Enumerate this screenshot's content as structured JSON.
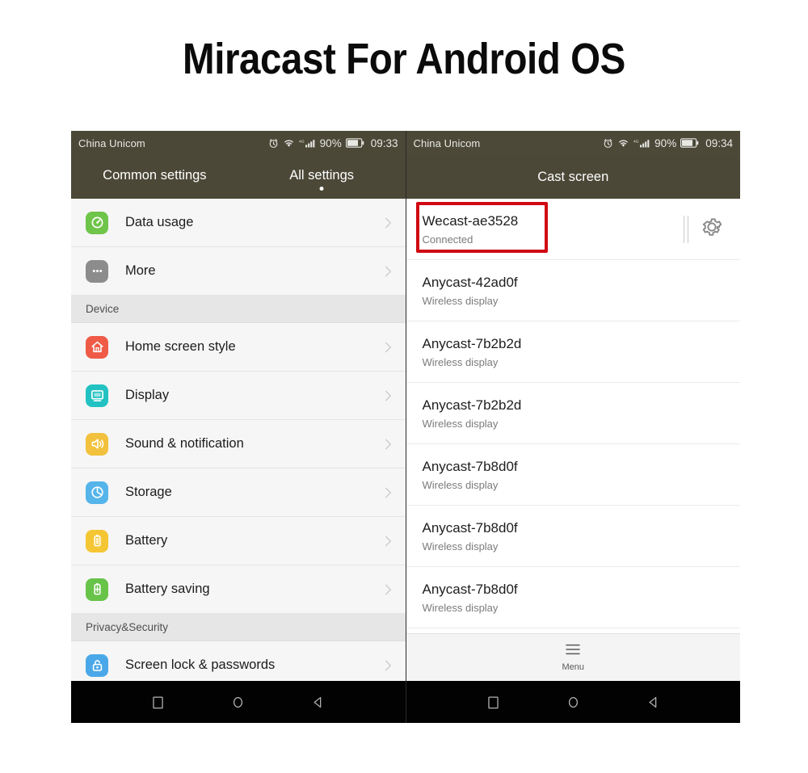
{
  "banner": {
    "title": "Miracast For Android OS"
  },
  "colors": {
    "header_bg": "#4b4837",
    "highlight_red": "#d00913",
    "page_bg": "#ffffff",
    "nav_bg": "#020202"
  },
  "left_phone": {
    "statusbar": {
      "carrier": "China Unicom",
      "network": "4G",
      "battery_percent": "90%",
      "clock": "09:33",
      "icons": [
        "alarm-icon",
        "wifi-icon",
        "signal-icon",
        "battery-icon"
      ]
    },
    "tabs": [
      {
        "label": "Common settings",
        "selected": false
      },
      {
        "label": "All settings",
        "selected": true
      }
    ],
    "rows": [
      {
        "type": "item",
        "label": "Data usage",
        "icon": "data-usage-icon",
        "icon_color": "#6fc44a",
        "highlighted": false
      },
      {
        "type": "item",
        "label": "More",
        "icon": "more-icon",
        "icon_color": "#8c8c8c",
        "highlighted": false
      },
      {
        "type": "section",
        "label": "Device"
      },
      {
        "type": "item",
        "label": "Home screen style",
        "icon": "home-icon",
        "icon_color": "#ef5b47",
        "highlighted": false
      },
      {
        "type": "item",
        "label": "Display",
        "icon": "display-icon",
        "icon_color": "#22c2c2",
        "highlighted": true
      },
      {
        "type": "item",
        "label": "Sound & notification",
        "icon": "sound-icon",
        "icon_color": "#f2c13d",
        "highlighted": false
      },
      {
        "type": "item",
        "label": "Storage",
        "icon": "storage-icon",
        "icon_color": "#55b4ea",
        "highlighted": false
      },
      {
        "type": "item",
        "label": "Battery",
        "icon": "battery-icon",
        "icon_color": "#f5c633",
        "highlighted": false
      },
      {
        "type": "item",
        "label": "Battery saving",
        "icon": "battery-saving-icon",
        "icon_color": "#68c349",
        "highlighted": false
      },
      {
        "type": "section",
        "label": "Privacy&Security"
      },
      {
        "type": "item",
        "label": "Screen lock & passwords",
        "icon": "lock-icon",
        "icon_color": "#4aa8e8",
        "highlighted": false
      }
    ],
    "navbar": [
      "recents-icon",
      "home-icon",
      "back-icon"
    ]
  },
  "right_phone": {
    "statusbar": {
      "carrier": "China Unicom",
      "network": "4G",
      "battery_percent": "90%",
      "clock": "09:34",
      "icons": [
        "alarm-icon",
        "wifi-icon",
        "signal-icon",
        "battery-icon"
      ]
    },
    "screen_title": "Cast screen",
    "devices": [
      {
        "name": "Wecast-ae3528",
        "status": "Connected",
        "highlighted": true,
        "has_settings": true
      },
      {
        "name": "Anycast-42ad0f",
        "status": "Wireless display",
        "highlighted": false,
        "has_settings": false
      },
      {
        "name": "Anycast-7b2b2d",
        "status": "Wireless display",
        "highlighted": false,
        "has_settings": false
      },
      {
        "name": "Anycast-7b2b2d",
        "status": "Wireless display",
        "highlighted": false,
        "has_settings": false
      },
      {
        "name": "Anycast-7b8d0f",
        "status": "Wireless display",
        "highlighted": false,
        "has_settings": false
      },
      {
        "name": "Anycast-7b8d0f",
        "status": "Wireless display",
        "highlighted": false,
        "has_settings": false
      },
      {
        "name": "Anycast-7b8d0f",
        "status": "Wireless display",
        "highlighted": false,
        "has_settings": false
      }
    ],
    "menu": {
      "label": "Menu",
      "icon": "hamburger-icon"
    },
    "navbar": [
      "recents-icon",
      "home-icon",
      "back-icon"
    ]
  }
}
